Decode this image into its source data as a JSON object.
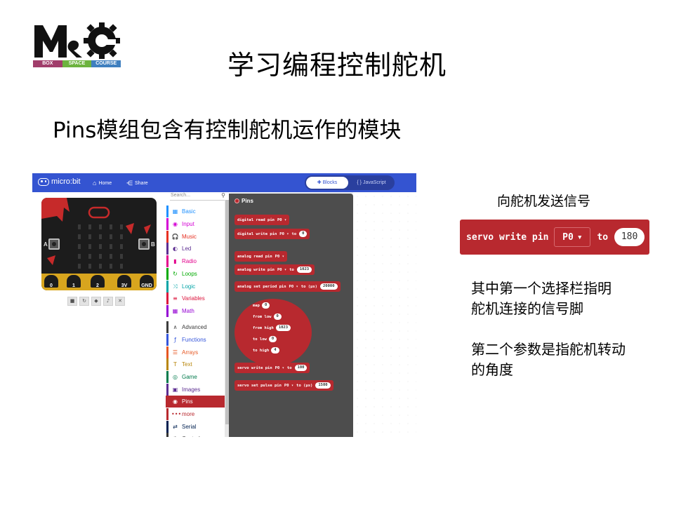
{
  "logo": {
    "strip": [
      "BOX",
      "SPACE",
      "COURSE"
    ]
  },
  "slide": {
    "title": "学习编程控制舵机",
    "subtitle": "Pins模组包含有控制舵机运作的模块"
  },
  "editor": {
    "brand": "micro:bit",
    "nav": {
      "home": "Home",
      "share": "Share"
    },
    "mode_toggle": {
      "blocks": "Blocks",
      "javascript": "{ } JavaScript"
    },
    "simulator": {
      "button_a": "A",
      "button_b": "B",
      "pins": [
        "0",
        "1",
        "2",
        "3V",
        "GND"
      ],
      "controls": [
        "stop-icon",
        "restart-icon",
        "slowmo-icon",
        "mute-icon",
        "fullscreen-icon"
      ]
    },
    "toolbox": {
      "search_placeholder": "Search...",
      "categories": [
        {
          "label": "Basic",
          "color": "#1e90ff",
          "icon": "▦"
        },
        {
          "label": "Input",
          "color": "#d400d4",
          "icon": "◉"
        },
        {
          "label": "Music",
          "color": "#e63022",
          "icon": "🎧"
        },
        {
          "label": "Led",
          "color": "#5c2d91",
          "icon": "◐"
        },
        {
          "label": "Radio",
          "color": "#e3008c",
          "icon": "▮"
        },
        {
          "label": "Loops",
          "color": "#00aa00",
          "icon": "↻"
        },
        {
          "label": "Logic",
          "color": "#00a4a6",
          "icon": "⤨"
        },
        {
          "label": "Variables",
          "color": "#dc143c",
          "icon": "≡"
        },
        {
          "label": "Math",
          "color": "#9400d3",
          "icon": "▦"
        },
        {
          "label": "Advanced",
          "color": "#3c3c3c",
          "icon": "∧"
        },
        {
          "label": "Functions",
          "color": "#3455db",
          "icon": "ƒ"
        },
        {
          "label": "Arrays",
          "color": "#e65722",
          "icon": "☰"
        },
        {
          "label": "Text",
          "color": "#b8860b",
          "icon": "T"
        },
        {
          "label": "Game",
          "color": "#007a4b",
          "icon": "◎"
        },
        {
          "label": "Images",
          "color": "#5c2d91",
          "icon": "▣"
        },
        {
          "label": "Pins",
          "color": "#b8292f",
          "icon": "◉"
        },
        {
          "label": "more",
          "color": "#b8292f",
          "icon": "•••"
        },
        {
          "label": "Serial",
          "color": "#002050",
          "icon": "⇄"
        },
        {
          "label": "Control",
          "color": "#333333",
          "icon": "⚙"
        }
      ]
    },
    "flyout": {
      "title": "Pins",
      "blocks": [
        {
          "text": "digital read pin",
          "pin": "P0 ▾"
        },
        {
          "text": "digital write pin",
          "pin": "P0 ▾",
          "to": "to",
          "value": "0"
        },
        {
          "text": "analog read pin",
          "pin": "P0 ▾"
        },
        {
          "text": "analog write pin",
          "pin": "P0 ▾",
          "to": "to",
          "value": "1023"
        },
        {
          "text": "analog set period pin",
          "pin": "P0 ▾",
          "to": "to (µs)",
          "value": "20000"
        },
        {
          "text": "servo write pin",
          "pin": "P0 ▾",
          "to": "to",
          "value": "180"
        },
        {
          "text": "servo set pulse pin",
          "pin": "P0 ▾",
          "to": "to (µs)",
          "value": "1500"
        }
      ],
      "map": [
        {
          "label": "map",
          "value": "0"
        },
        {
          "label": "from low",
          "value": "0"
        },
        {
          "label": "from high",
          "value": "1023"
        },
        {
          "label": "to low",
          "value": "0"
        },
        {
          "label": "to high",
          "value": "4"
        }
      ]
    }
  },
  "right": {
    "caption": "向舵机发送信号",
    "servo_block": {
      "text": "servo write pin",
      "pin": "P0",
      "to": "to",
      "value": "180"
    },
    "note1_line1": "其中第一个选择栏指明",
    "note1_line2": "舵机连接的信号脚",
    "note2_line1": "第二个参数是指舵机转动",
    "note2_line2": "的角度"
  }
}
